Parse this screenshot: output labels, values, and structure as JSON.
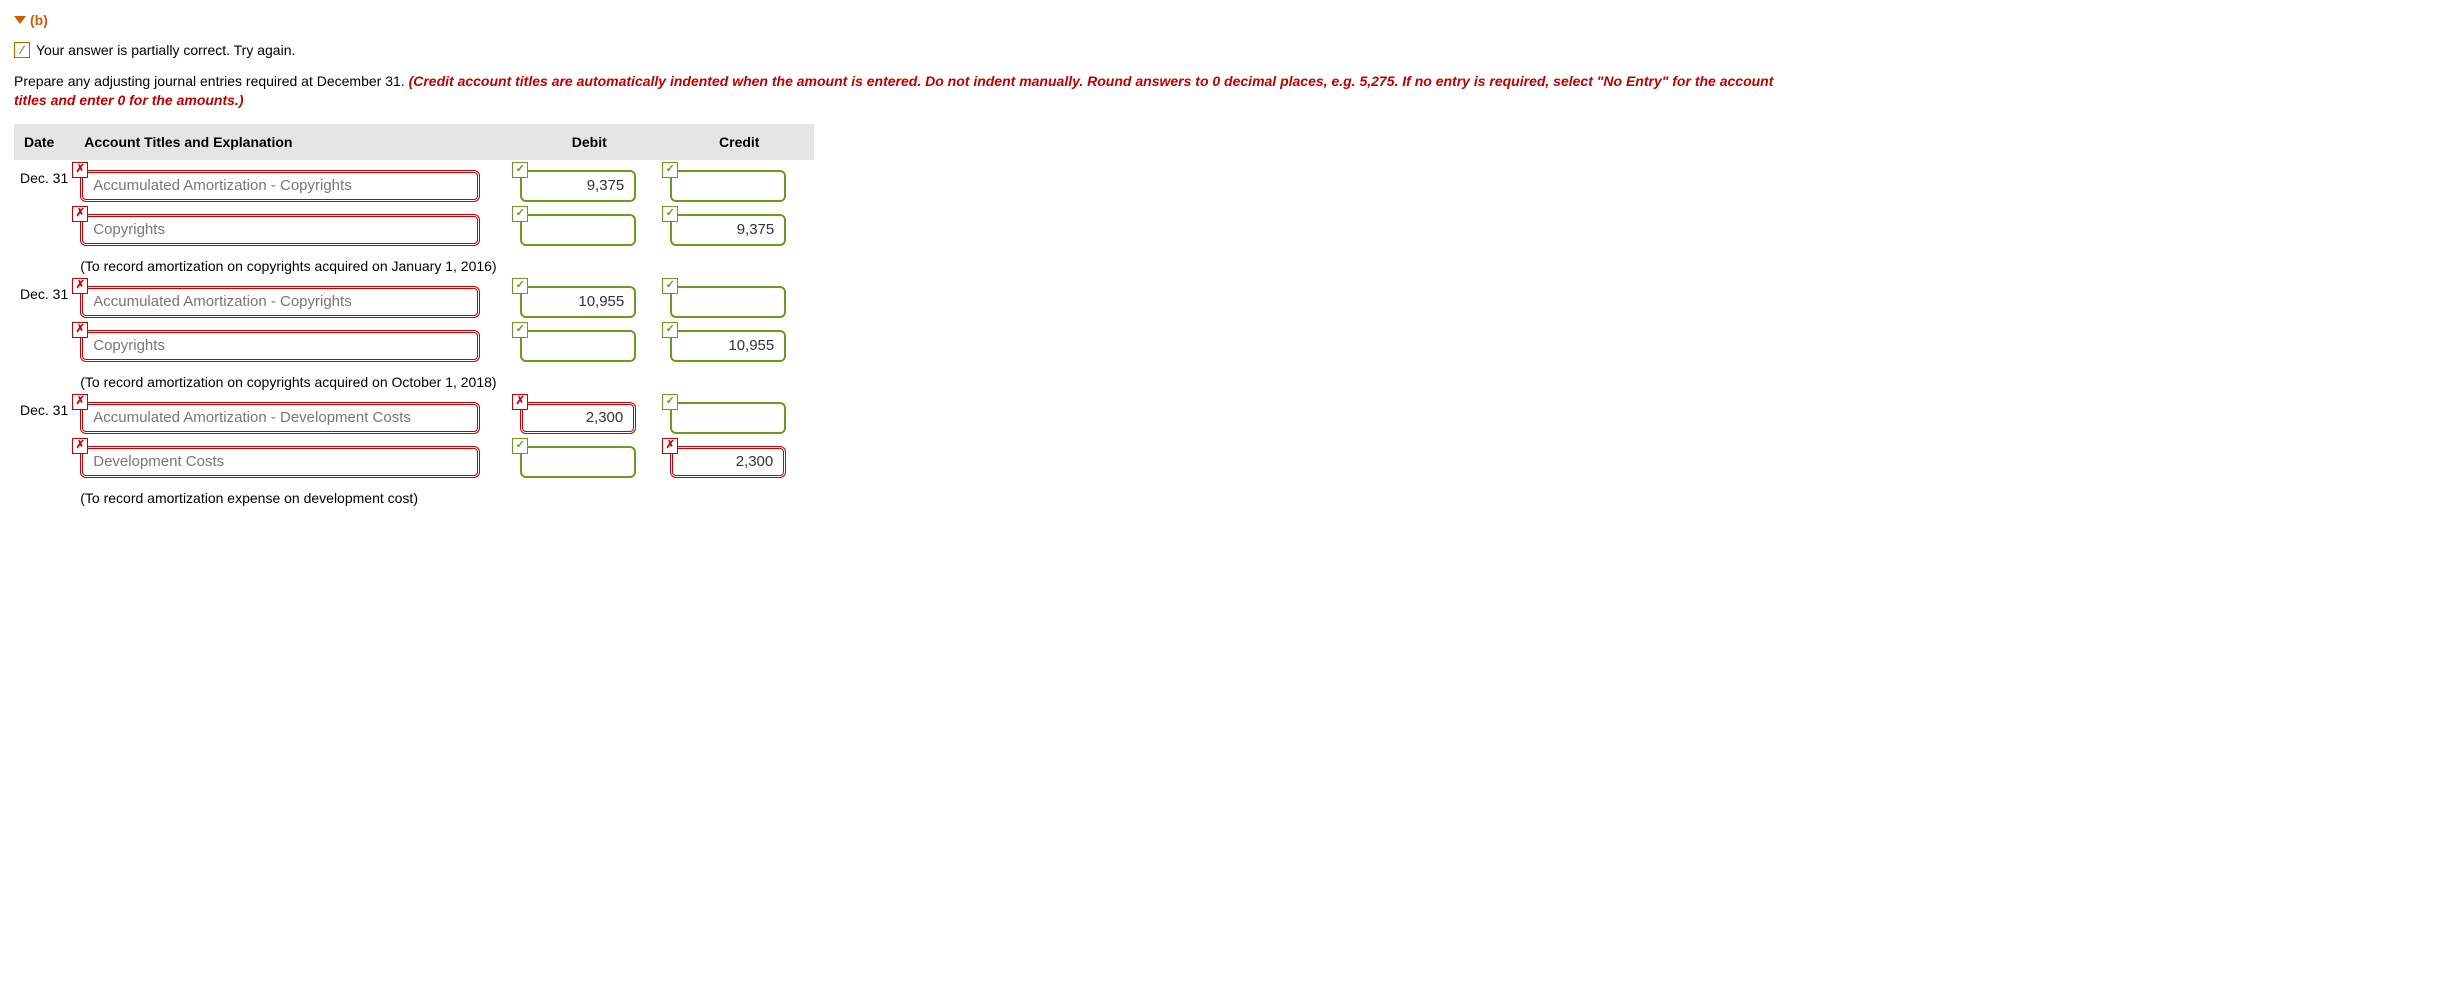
{
  "header": {
    "part_label": "(b)",
    "partial_msg": "Your answer is partially correct.  Try again.",
    "instr_plain": "Prepare any adjusting journal entries required at December 31. ",
    "instr_red": "(Credit account titles are automatically indented when the amount is entered. Do not indent manually. Round answers to 0 decimal places, e.g. 5,275. If no entry is required, select \"No Entry\" for the account titles and enter 0 for the amounts.)"
  },
  "columns": {
    "date": "Date",
    "acct": "Account Titles and Explanation",
    "debit": "Debit",
    "credit": "Credit"
  },
  "entries": [
    {
      "date": "Dec. 31",
      "lines": [
        {
          "account": "Accumulated Amortization - Copyrights",
          "account_status": "wrong",
          "indent": false,
          "debit": "9,375",
          "debit_status": "correct",
          "credit": "",
          "credit_status": "correct"
        },
        {
          "account": "Copyrights",
          "account_status": "wrong",
          "indent": true,
          "debit": "",
          "debit_status": "correct",
          "credit": "9,375",
          "credit_status": "correct"
        }
      ],
      "explain": "(To record amortization on copyrights acquired on January 1, 2016)"
    },
    {
      "date": "Dec. 31",
      "lines": [
        {
          "account": "Accumulated Amortization - Copyrights",
          "account_status": "wrong",
          "indent": false,
          "debit": "10,955",
          "debit_status": "correct",
          "credit": "",
          "credit_status": "correct"
        },
        {
          "account": "Copyrights",
          "account_status": "wrong",
          "indent": true,
          "debit": "",
          "debit_status": "correct",
          "credit": "10,955",
          "credit_status": "correct"
        }
      ],
      "explain": "(To record amortization on copyrights acquired on October 1, 2018)"
    },
    {
      "date": "Dec. 31",
      "lines": [
        {
          "account": "Accumulated Amortization - Development Costs",
          "account_status": "wrong",
          "indent": false,
          "debit": "2,300",
          "debit_status": "wrong",
          "credit": "",
          "credit_status": "correct"
        },
        {
          "account": "Development Costs",
          "account_status": "wrong",
          "indent": true,
          "debit": "",
          "debit_status": "correct",
          "credit": "2,300",
          "credit_status": "wrong"
        }
      ],
      "explain": "(To record amortization expense on development cost)"
    }
  ]
}
